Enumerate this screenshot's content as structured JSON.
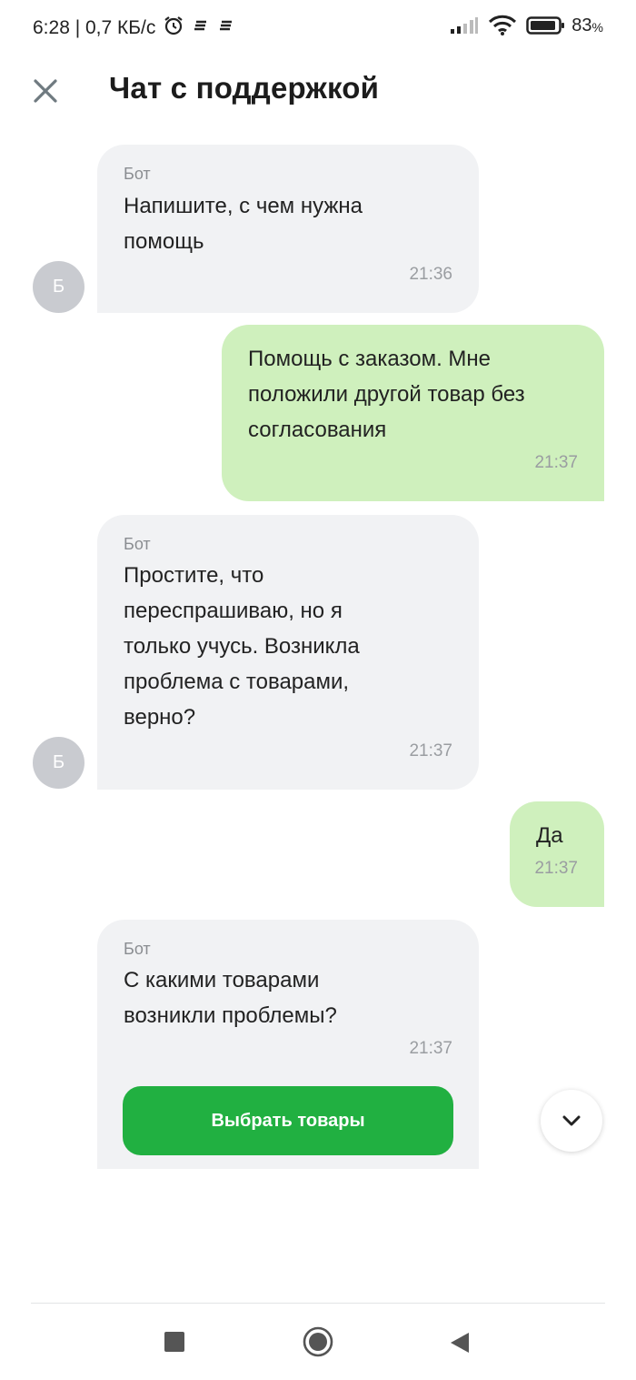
{
  "status_bar": {
    "time_speed": "6:28 | 0,7 КБ/с",
    "battery": "83",
    "battery_unit": "%",
    "icons": [
      "alarm-icon",
      "notification-icon",
      "notification-icon",
      "signal-icon",
      "wifi-icon",
      "battery-icon"
    ]
  },
  "header": {
    "title": "Чат с поддержкой",
    "close_icon": "close-icon"
  },
  "messages": [
    {
      "from": "bot",
      "sender": "Бот",
      "text_lines": [
        "Напишите, с чем нужна",
        "помощь"
      ],
      "time": "21:36",
      "avatar": "Б"
    },
    {
      "from": "user",
      "text_lines": [
        "Помощь с заказом. Мне",
        "положили другой товар без",
        "согласования"
      ],
      "time": "21:37"
    },
    {
      "from": "bot",
      "sender": "Бот",
      "text_lines": [
        "Простите, что",
        "переспрашиваю, но я",
        "только учусь. Возникла",
        "проблема с товарами,",
        "верно?"
      ],
      "time": "21:37",
      "avatar": "Б"
    },
    {
      "from": "user",
      "text_lines": [
        "Да"
      ],
      "time": "21:37"
    },
    {
      "from": "bot",
      "sender": "Бот",
      "text_lines": [
        "С какими товарами",
        "возникли проблемы?"
      ],
      "time": "21:37",
      "button": "Выбрать товары"
    }
  ],
  "colors": {
    "bot_bubble": "#f1f2f4",
    "user_bubble": "#cff0bd",
    "accent": "#21b041"
  },
  "nav_bar": {
    "icons": [
      "recent-apps-icon",
      "home-icon",
      "back-icon"
    ]
  }
}
